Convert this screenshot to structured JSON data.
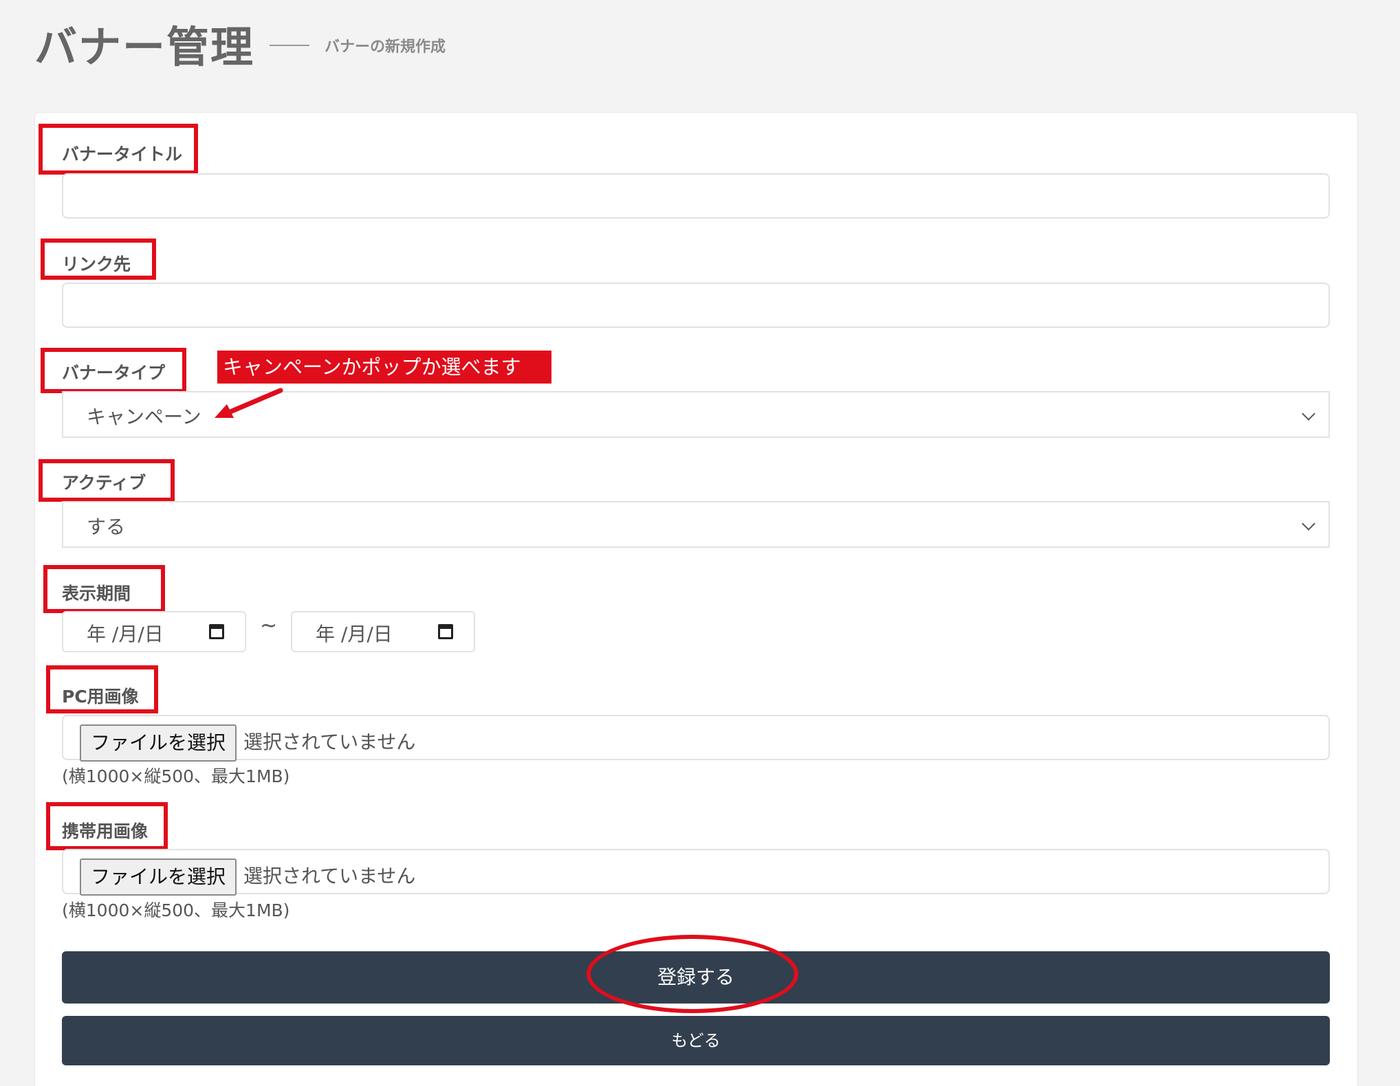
{
  "header": {
    "title": "バナー管理",
    "subtitle": "バナーの新規作成"
  },
  "form": {
    "title_label": "バナータイトル",
    "title_value": "",
    "link_label": "リンク先",
    "link_value": "",
    "type_label": "バナータイプ",
    "type_selected": "キャンペーン",
    "active_label": "アクティブ",
    "active_selected": "する",
    "period_label": "表示期間",
    "date_placeholder": "年 /月/日",
    "period_separator": "~",
    "pc_image_label": "PC用画像",
    "mobile_image_label": "携帯用画像",
    "file_button": "ファイルを選択",
    "file_status": "選択されていません",
    "image_hint": "(横1000×縦500、最大1MB)",
    "submit_label": "登録する",
    "back_label": "もどる"
  },
  "annotations": {
    "callout_text": "キャンペーンかポップか選べます",
    "annotation_color": "#e00d1b"
  },
  "colors": {
    "button_bg": "#323f4e",
    "page_bg": "#f3f3f3"
  }
}
